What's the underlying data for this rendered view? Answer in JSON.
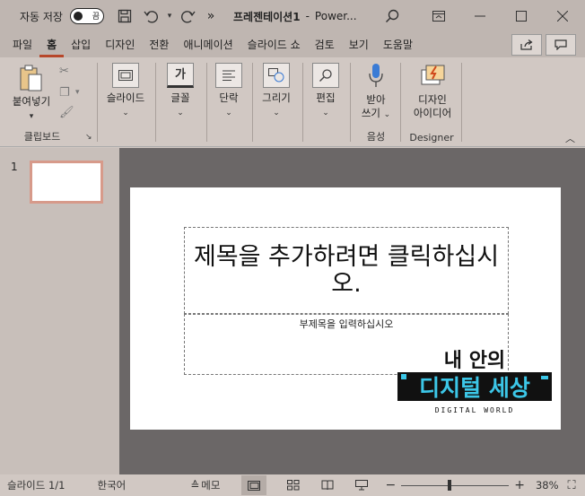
{
  "titlebar": {
    "autosave_label": "자동 저장",
    "toggle_text": "끔",
    "doc_title": "프레젠테이션1",
    "separator": "-",
    "app_name": "Power...",
    "more": "»"
  },
  "tabs": [
    "파일",
    "홈",
    "삽입",
    "디자인",
    "전환",
    "애니메이션",
    "슬라이드 쇼",
    "검토",
    "보기",
    "도움말"
  ],
  "ribbon": {
    "paste_label": "붙여넣기",
    "clipboard_group": "클립보드",
    "slides_label": "슬라이드",
    "font_label": "글꼴",
    "font_icon_text": "가",
    "paragraph_label": "단락",
    "drawing_label": "그리기",
    "editing_label": "편집",
    "dictate_label_1": "받아",
    "dictate_label_2": "쓰기",
    "voice_group": "음성",
    "designer_label_1": "디자인",
    "designer_label_2": "아이디어",
    "designer_group": "Designer"
  },
  "thumbnail": {
    "number": "1"
  },
  "slide": {
    "title_placeholder": "제목을 추가하려면 클릭하십시오.",
    "subtitle_placeholder": "부제목을 입력하십시오"
  },
  "logo": {
    "line1": "내 안의",
    "line2": "디지털 세상",
    "line3": "DIGITAL WORLD"
  },
  "statusbar": {
    "slide_info": "슬라이드 1/1",
    "language": "한국어",
    "notes_label": "메모",
    "zoom": "38%",
    "zoom_level_fraction": 0.45
  },
  "colors": {
    "accent": "#b7472a",
    "thumb_border": "#d79a8a",
    "stage_bg": "#6b6767",
    "logo_cyan": "#3cc7e8"
  }
}
